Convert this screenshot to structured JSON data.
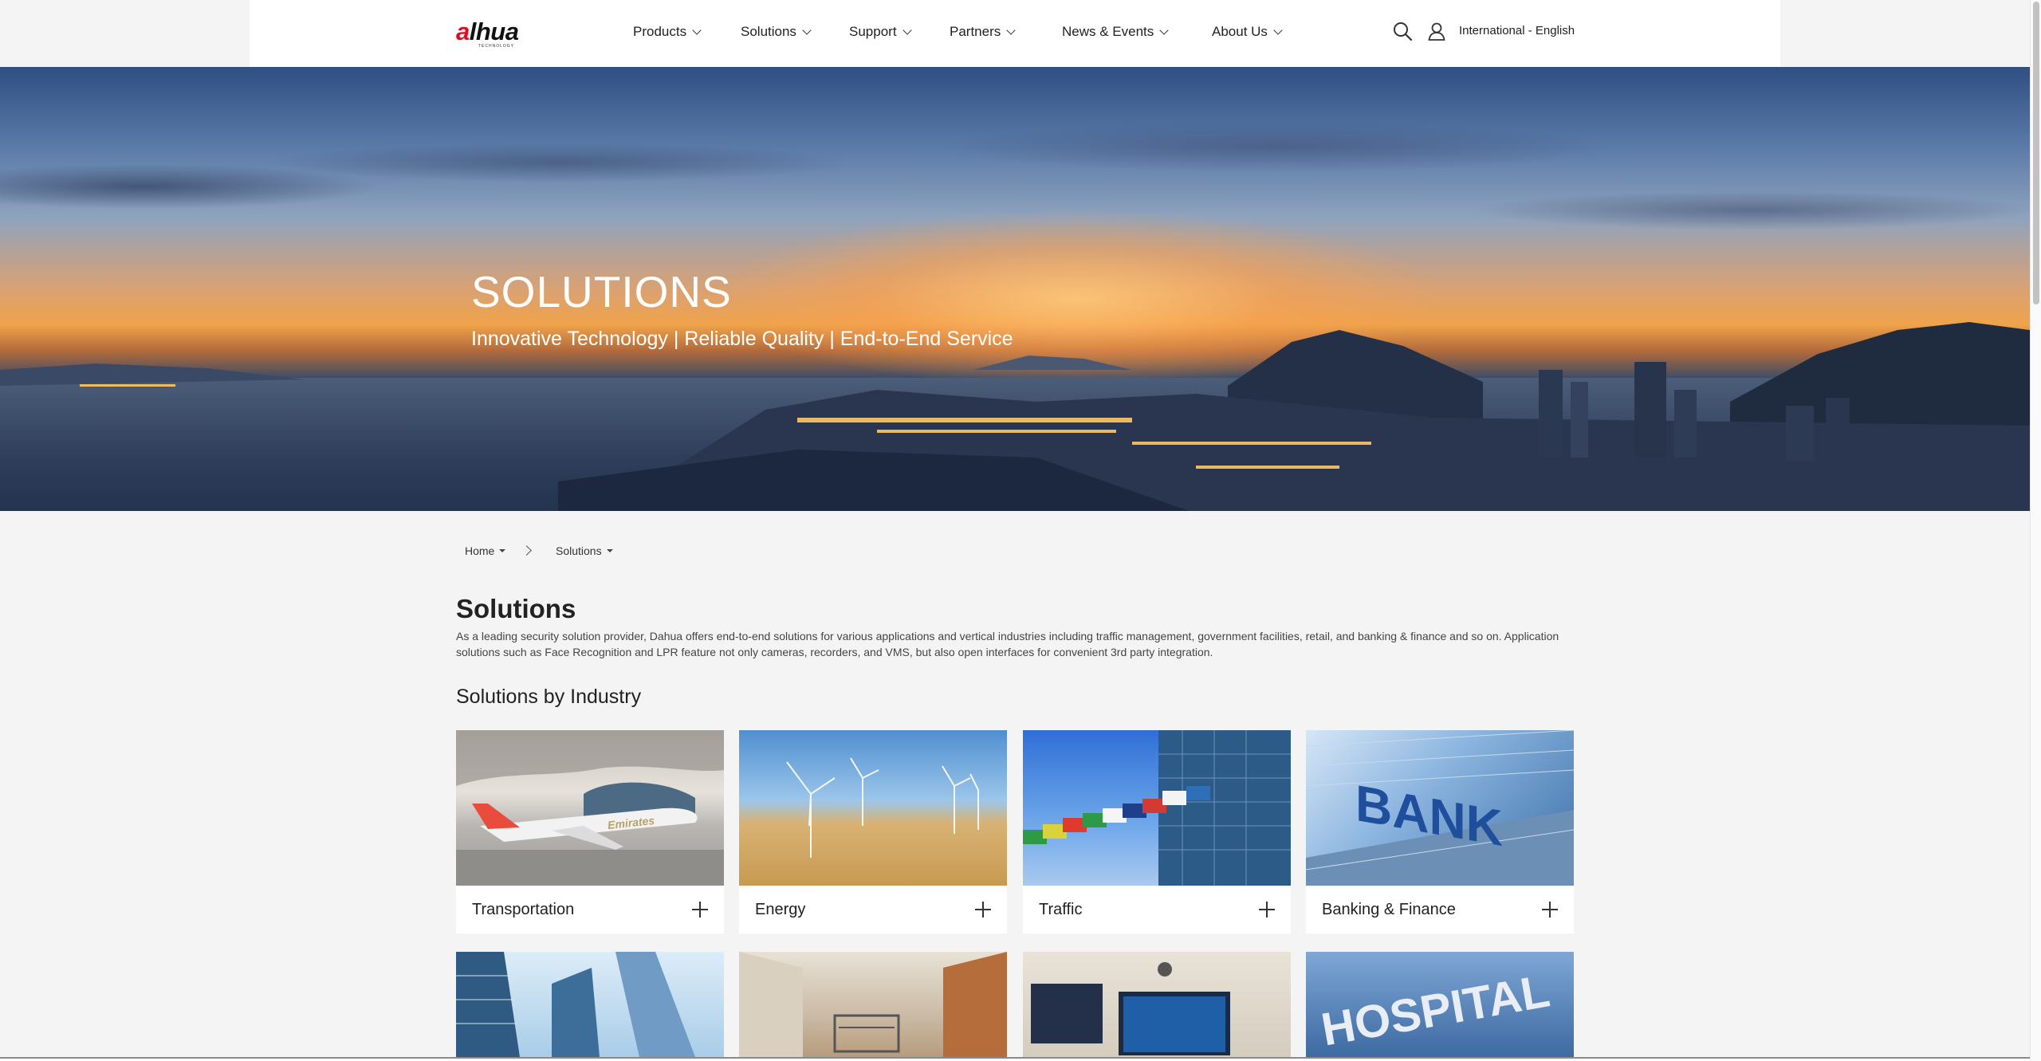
{
  "header": {
    "logo_text": "alhua",
    "logo_sub": "TECHNOLOGY",
    "nav": [
      "Products",
      "Solutions",
      "Support",
      "Partners",
      "News & Events",
      "About Us"
    ],
    "language": "International - English",
    "icons": [
      "search-icon",
      "user-icon"
    ]
  },
  "hero": {
    "title": "SOLUTIONS",
    "subtitle": "Innovative Technology | Reliable Quality | End-to-End Service"
  },
  "breadcrumb": {
    "home": "Home",
    "current": "Solutions"
  },
  "intro": {
    "title": "Solutions",
    "text": "As a leading security solution provider, Dahua offers end-to-end solutions for various applications and vertical industries including traffic management, government facilities, retail, and banking & finance and so on. Application solutions such as Face Recognition and LPR feature not only cameras, recorders, and VMS, but also open interfaces for convenient 3rd party integration."
  },
  "industries": {
    "title": "Solutions by Industry",
    "cards": [
      {
        "label": "Transportation",
        "image": "airport-plane"
      },
      {
        "label": "Energy",
        "image": "wind-turbines"
      },
      {
        "label": "Traffic",
        "image": "flags-building"
      },
      {
        "label": "Banking & Finance",
        "image": "bank-building"
      }
    ],
    "second_row_images": [
      "skyscrapers",
      "shopping-mall",
      "classroom-screen",
      "hospital-sign"
    ],
    "image_text": {
      "bank": "BANK",
      "hospital": "HOSPITAL",
      "plane": "Emirates"
    }
  },
  "colors": {
    "brand_red": "#e10a1e",
    "page_bg": "#f4f4f4",
    "card_bg": "#ffffff"
  }
}
